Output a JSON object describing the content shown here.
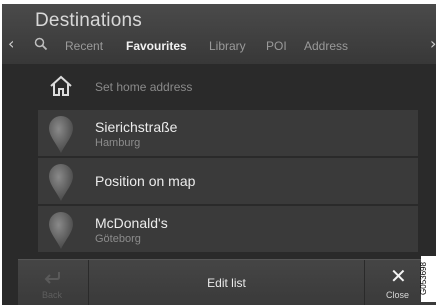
{
  "header": {
    "title": "Destinations",
    "prev_arrow": "‹",
    "next_arrow": "›",
    "search_icon": "search-icon",
    "tabs": [
      {
        "label": "Recent",
        "active": false
      },
      {
        "label": "Favourites",
        "active": true
      },
      {
        "label": "Library",
        "active": false
      },
      {
        "label": "POI",
        "active": false
      },
      {
        "label": "Address",
        "active": false
      }
    ]
  },
  "home": {
    "icon": "home-icon",
    "label": "Set home address"
  },
  "favourites": [
    {
      "name": "Sierichstraße",
      "subtitle": "Hamburg",
      "icon": "map-pin-icon"
    },
    {
      "name": "Position on map",
      "subtitle": "",
      "icon": "map-pin-icon"
    },
    {
      "name": "McDonald's",
      "subtitle": "Göteborg",
      "icon": "map-pin-icon"
    }
  ],
  "bottom_bar": {
    "back_label": "Back",
    "edit_label": "Edit list",
    "close_icon": "✕",
    "close_label": "Close"
  },
  "figure_code": "G053698",
  "colors": {
    "background": "#2a2a2a",
    "row": "#3a3a3a",
    "active_tab": "#f2f2f2",
    "inactive_tab": "#9a9a9a"
  }
}
